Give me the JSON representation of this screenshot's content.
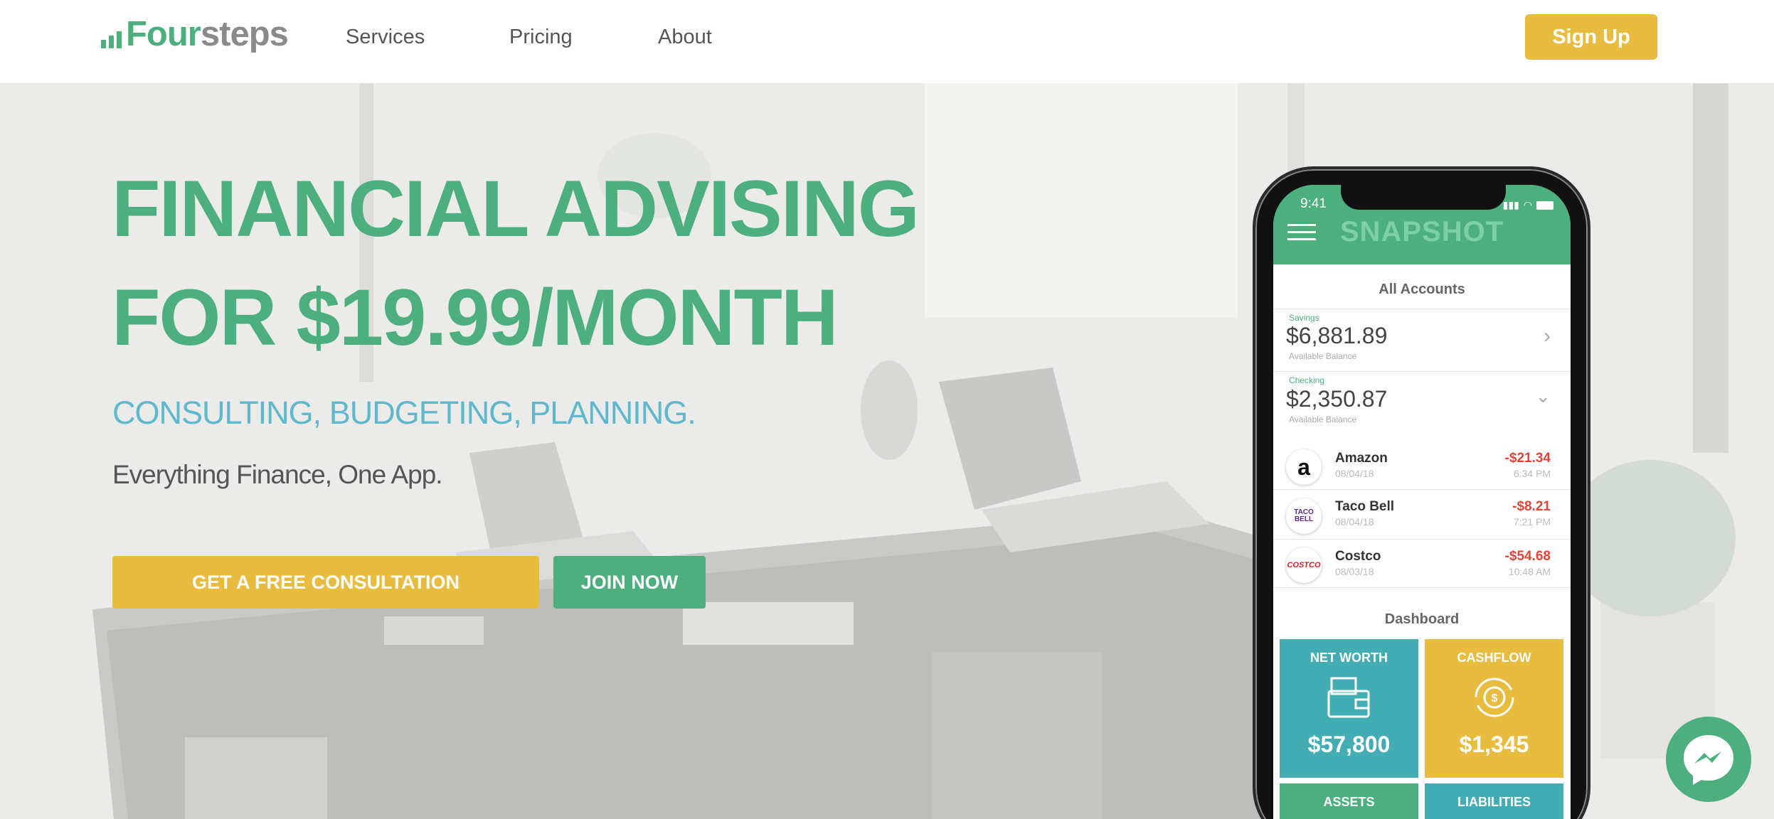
{
  "nav": {
    "logo_part1": "Four",
    "logo_part2": "steps",
    "links": [
      "Services",
      "Pricing",
      "About"
    ],
    "signup": "Sign Up"
  },
  "hero": {
    "headline_line1": "FINANCIAL ADVISING",
    "headline_line2": "FOR $19.99/MONTH",
    "subheadline": "CONSULTING, BUDGETING, PLANNING.",
    "tagline": "Everything Finance, One App.",
    "cta_primary": "GET A FREE CONSULTATION",
    "cta_secondary": "JOIN NOW"
  },
  "phone": {
    "time": "9:41",
    "title": "SNAPSHOT",
    "all_accounts": "All Accounts",
    "accounts": [
      {
        "type": "Savings",
        "amount": "$6,881.89",
        "note": "Available Balance"
      },
      {
        "type": "Checking",
        "amount": "$2,350.87",
        "note": "Available Balance"
      }
    ],
    "transactions": [
      {
        "name": "Amazon",
        "date": "08/04/18",
        "amount": "-$21.34",
        "time": "6:34 PM",
        "icon": "a"
      },
      {
        "name": "Taco Bell",
        "date": "08/04/18",
        "amount": "-$8.21",
        "time": "7:21 PM",
        "icon": "TACO BELL"
      },
      {
        "name": "Costco",
        "date": "08/03/18",
        "amount": "-$54.68",
        "time": "10:48 AM",
        "icon": "COSTCO"
      }
    ],
    "dashboard": "Dashboard",
    "tiles": [
      {
        "label": "NET WORTH",
        "value": "$57,800",
        "color": "#44adb3"
      },
      {
        "label": "CASHFLOW",
        "value": "$1,345",
        "color": "#e8bc3e"
      },
      {
        "label": "ASSETS",
        "value": "",
        "color": "#4caf7d"
      },
      {
        "label": "LIABILITIES",
        "value": "",
        "color": "#44adb3"
      }
    ]
  },
  "colors": {
    "green": "#4caf7d",
    "yellow": "#e8bc3e",
    "teal": "#5fb8cc",
    "red": "#e0453a"
  }
}
